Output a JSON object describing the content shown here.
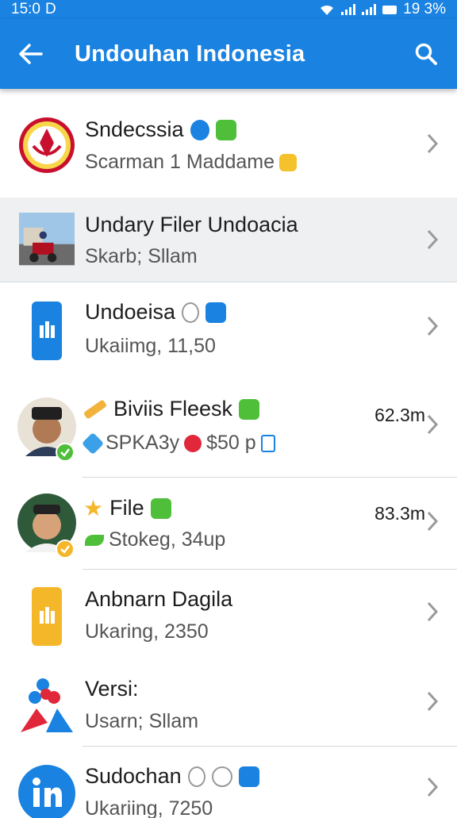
{
  "status_bar": {
    "time": "15:0",
    "indicator": "D",
    "battery": "19 3%"
  },
  "app_bar": {
    "title": "Undouhan Indonesia",
    "back_icon": "arrow-left-icon",
    "search_icon": "search-icon"
  },
  "items": [
    {
      "name": "Sndecssia",
      "sub": "Scarman 1 Maddame",
      "meta": ""
    },
    {
      "name": "Undary Filer Undoacia",
      "sub": "Skarb; Sllam",
      "meta": ""
    },
    {
      "name": "Undoeisa",
      "sub": "Ukaiimg, 11,50",
      "meta": ""
    },
    {
      "name": "Biviis Fleesk",
      "sub_a": "SPKA3y",
      "sub_b": "$50 p",
      "meta": "62.3m"
    },
    {
      "name": "File",
      "sub": "Stokeg, 34up",
      "meta": "83.3m"
    },
    {
      "name": "Anbnarn Dagila",
      "sub": "Ukaring, 2350",
      "meta": ""
    },
    {
      "name": "Versi:",
      "sub": "Usarn; Sllam",
      "meta": ""
    },
    {
      "name": "Sudochan",
      "sub": "Ukariing, 7250",
      "meta": ""
    }
  ],
  "colors": {
    "primary": "#1a82e0",
    "verified_green": "#4fbf3a",
    "badge_orange": "#f5b72a"
  }
}
